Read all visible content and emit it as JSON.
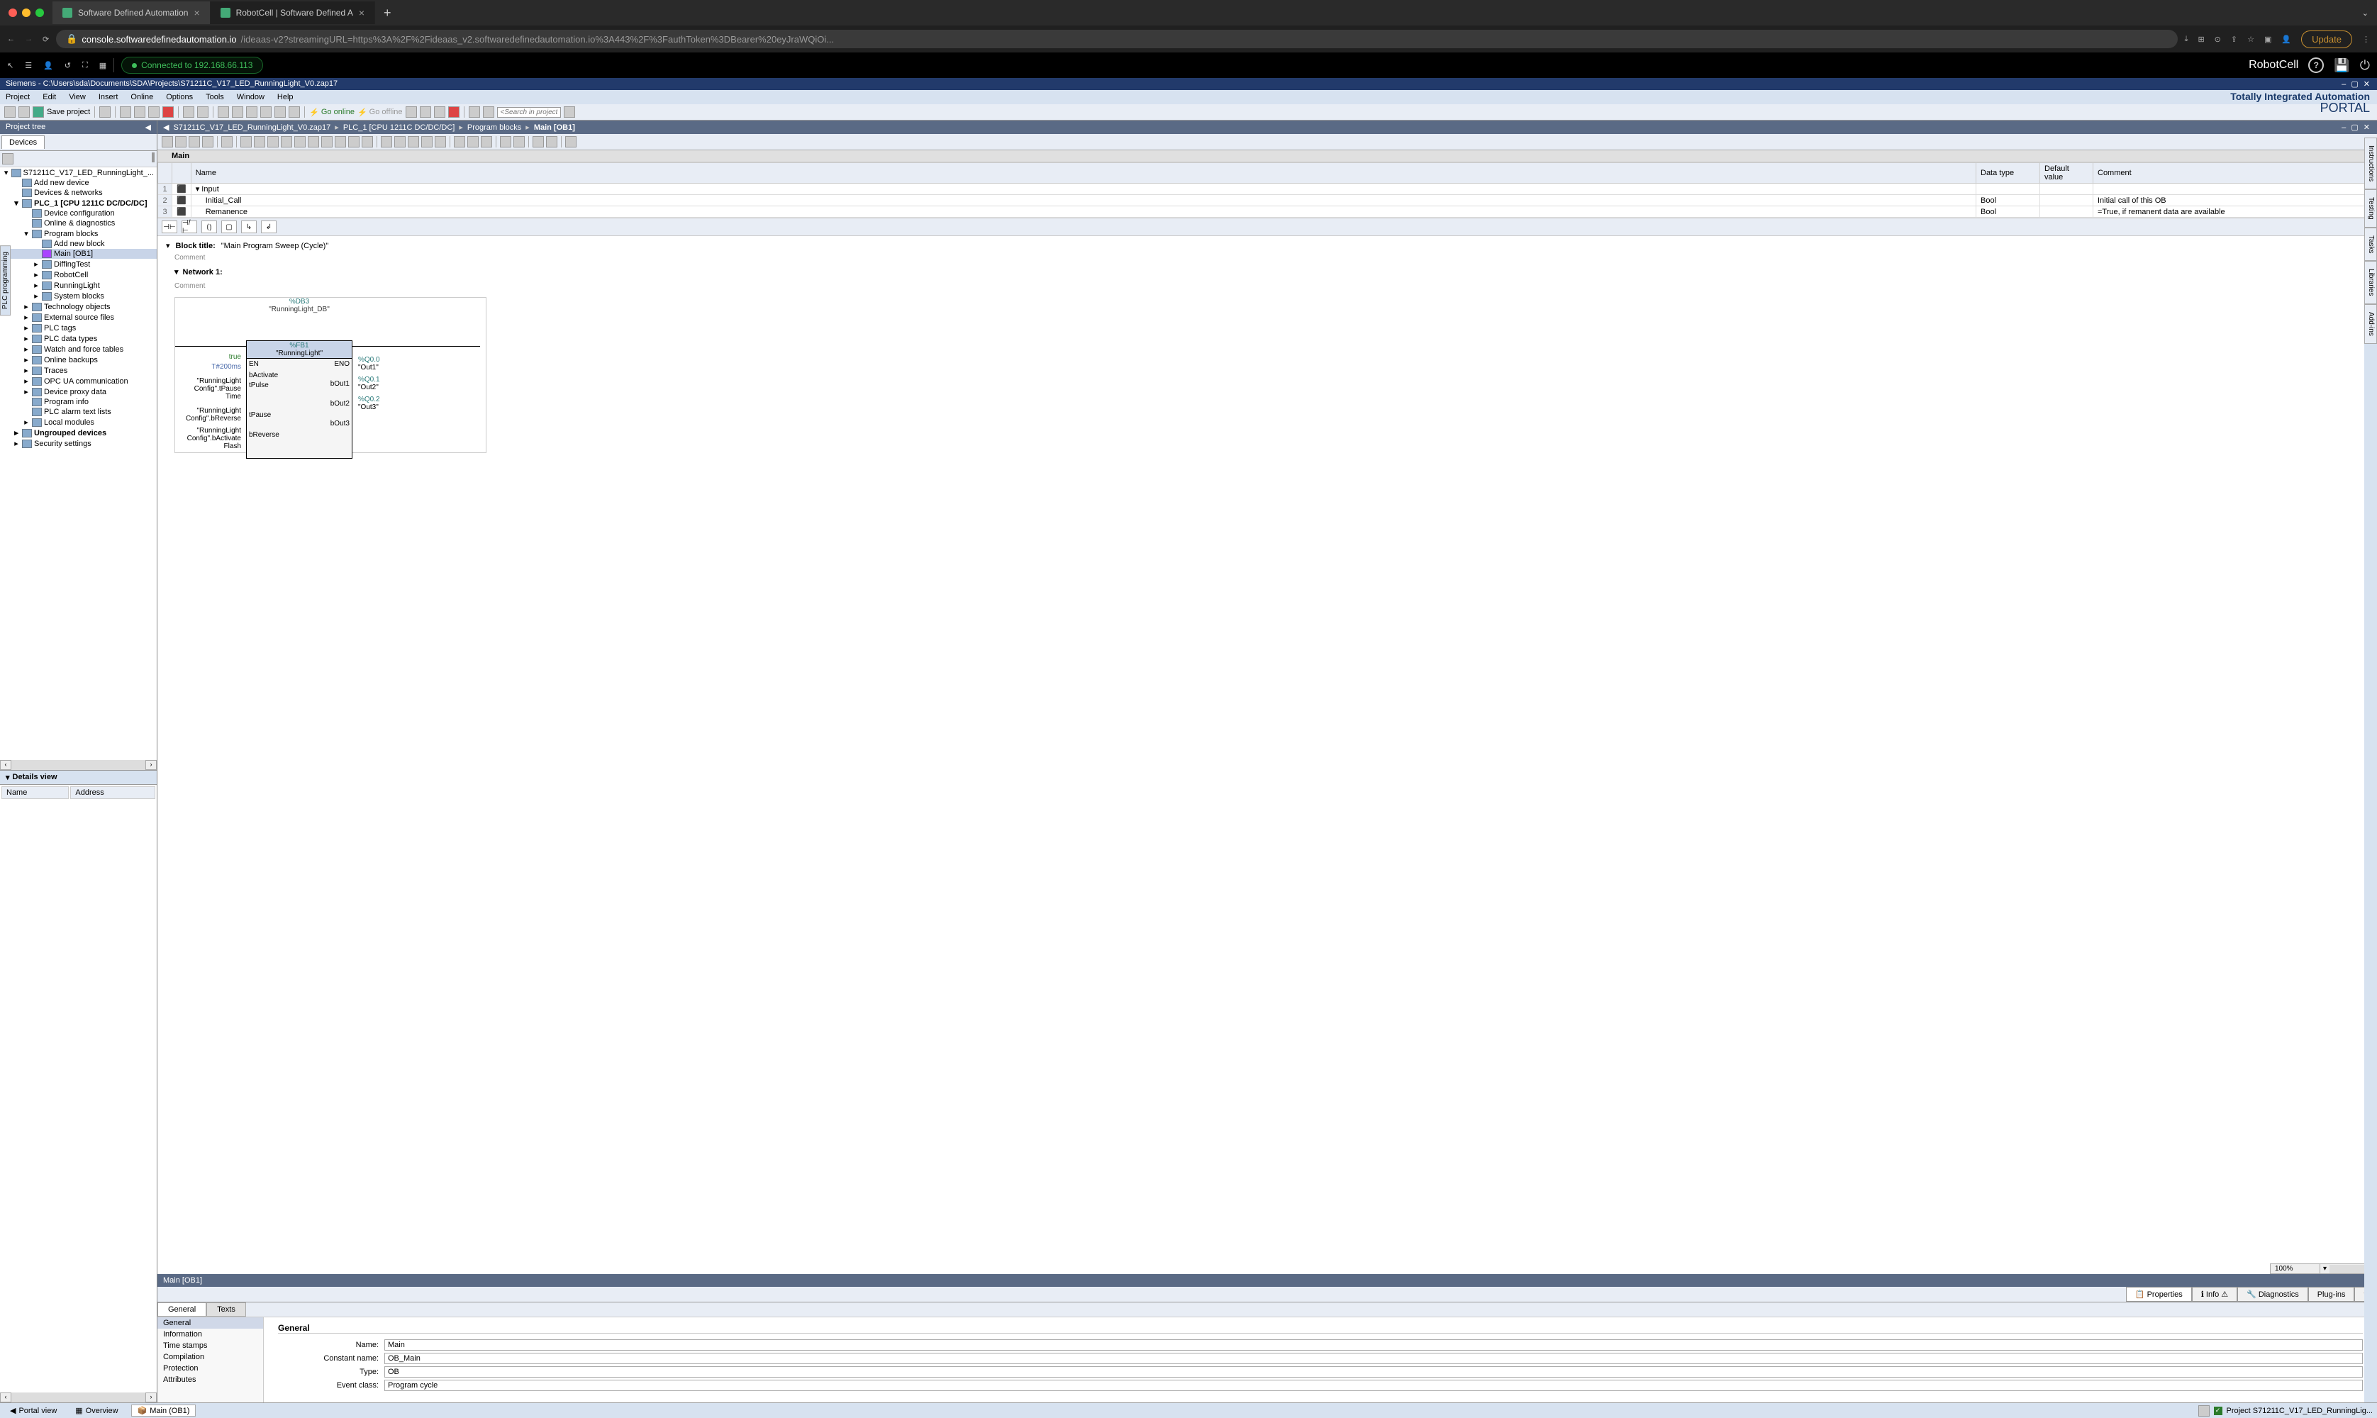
{
  "browser": {
    "tabs": [
      {
        "title": "Software Defined Automation",
        "active": false
      },
      {
        "title": "RobotCell | Software Defined A",
        "active": true
      }
    ],
    "url_domain": "console.softwaredefinedautomation.io",
    "url_path": "/ideaas-v2?streamingURL=https%3A%2F%2Fideaas_v2.softwaredefinedautomation.io%3A443%2F%3FauthToken%3DBearer%20eyJraWQiOi...",
    "update_label": "Update"
  },
  "app_bar": {
    "connected_text": "Connected to 192.168.66.113",
    "title": "RobotCell"
  },
  "tia": {
    "titlebar": "Siemens - C:\\Users\\sda\\Documents\\SDA\\Projects\\S71211C_V17_LED_RunningLight_V0.zap17",
    "branding_top": "Totally Integrated Automation",
    "branding_bottom": "PORTAL",
    "menus": [
      "Project",
      "Edit",
      "View",
      "Insert",
      "Online",
      "Options",
      "Tools",
      "Window",
      "Help"
    ],
    "toolbar": {
      "save_project": "Save project",
      "go_online": "Go online",
      "go_offline": "Go offline",
      "search_placeholder": "<Search in project>"
    },
    "project_tree_label": "Project tree",
    "devices_label": "Devices",
    "tree": [
      {
        "indent": 0,
        "arrow": "▾",
        "label": "S71211C_V17_LED_RunningLight_..."
      },
      {
        "indent": 1,
        "arrow": "",
        "label": "Add new device"
      },
      {
        "indent": 1,
        "arrow": "",
        "label": "Devices & networks"
      },
      {
        "indent": 1,
        "arrow": "▾",
        "label": "PLC_1 [CPU 1211C DC/DC/DC]",
        "bold": true
      },
      {
        "indent": 2,
        "arrow": "",
        "label": "Device configuration"
      },
      {
        "indent": 2,
        "arrow": "",
        "label": "Online & diagnostics"
      },
      {
        "indent": 2,
        "arrow": "▾",
        "label": "Program blocks"
      },
      {
        "indent": 3,
        "arrow": "",
        "label": "Add new block"
      },
      {
        "indent": 3,
        "arrow": "",
        "label": "Main [OB1]",
        "selected": true
      },
      {
        "indent": 3,
        "arrow": "▸",
        "label": "DiffingTest"
      },
      {
        "indent": 3,
        "arrow": "▸",
        "label": "RobotCell"
      },
      {
        "indent": 3,
        "arrow": "▸",
        "label": "RunningLight"
      },
      {
        "indent": 3,
        "arrow": "▸",
        "label": "System blocks"
      },
      {
        "indent": 2,
        "arrow": "▸",
        "label": "Technology objects"
      },
      {
        "indent": 2,
        "arrow": "▸",
        "label": "External source files"
      },
      {
        "indent": 2,
        "arrow": "▸",
        "label": "PLC tags"
      },
      {
        "indent": 2,
        "arrow": "▸",
        "label": "PLC data types"
      },
      {
        "indent": 2,
        "arrow": "▸",
        "label": "Watch and force tables"
      },
      {
        "indent": 2,
        "arrow": "▸",
        "label": "Online backups"
      },
      {
        "indent": 2,
        "arrow": "▸",
        "label": "Traces"
      },
      {
        "indent": 2,
        "arrow": "▸",
        "label": "OPC UA communication"
      },
      {
        "indent": 2,
        "arrow": "▸",
        "label": "Device proxy data"
      },
      {
        "indent": 2,
        "arrow": "",
        "label": "Program info"
      },
      {
        "indent": 2,
        "arrow": "",
        "label": "PLC alarm text lists"
      },
      {
        "indent": 2,
        "arrow": "▸",
        "label": "Local modules"
      },
      {
        "indent": 1,
        "arrow": "▸",
        "label": "Ungrouped devices",
        "bold": true
      },
      {
        "indent": 1,
        "arrow": "▸",
        "label": "Security settings"
      }
    ],
    "details_view_label": "Details view",
    "details_cols": [
      "Name",
      "Address"
    ],
    "breadcrumb": [
      "S71211C_V17_LED_RunningLight_V0.zap17",
      "PLC_1 [CPU 1211C DC/DC/DC]",
      "Program blocks",
      "Main [OB1]"
    ],
    "block_name": "Main",
    "interface_cols": [
      "Name",
      "Data type",
      "Default value",
      "Comment"
    ],
    "interface_rows": [
      {
        "num": "1",
        "name": "Input",
        "type": "",
        "default": "",
        "comment": "",
        "is_header": true
      },
      {
        "num": "2",
        "name": "Initial_Call",
        "type": "Bool",
        "default": "",
        "comment": "Initial call of this OB"
      },
      {
        "num": "3",
        "name": "Remanence",
        "type": "Bool",
        "default": "",
        "comment": "=True, if remanent data are available"
      }
    ],
    "block_title_label": "Block title:",
    "block_title_value": "\"Main Program Sweep (Cycle)\"",
    "comment_label": "Comment",
    "network_label": "Network 1:",
    "diagram": {
      "db_addr": "%DB3",
      "db_name": "\"RunningLight_DB\"",
      "fb_addr": "%FB1",
      "fb_name": "\"RunningLight\"",
      "en": "EN",
      "eno": "ENO",
      "inputs": [
        {
          "param": "bActivate",
          "value": "true",
          "color": "#2a7a2a"
        },
        {
          "param": "tPulse",
          "value": "T#200ms",
          "color": "#4a6aaa"
        },
        {
          "param": "tPause",
          "value": "\"RunningLight Config\".tPause Time"
        },
        {
          "param": "bReverse",
          "value": "\"RunningLight Config\".bReverse"
        },
        {
          "param": "",
          "value": "\"RunningLight Config\".bActivate Flash"
        }
      ],
      "outputs": [
        {
          "param": "bOut1",
          "addr": "%Q0.0",
          "name": "\"Out1\""
        },
        {
          "param": "bOut2",
          "addr": "%Q0.1",
          "name": "\"Out2\""
        },
        {
          "param": "bOut3",
          "addr": "%Q0.2",
          "name": "\"Out3\""
        }
      ]
    },
    "zoom": "100%",
    "inspector": {
      "header": "Main [OB1]",
      "tabs": [
        "Properties",
        "Info",
        "Diagnostics",
        "Plug-ins"
      ],
      "subtabs": [
        "General",
        "Texts"
      ],
      "sidebar": [
        "General",
        "Information",
        "Time stamps",
        "Compilation",
        "Protection",
        "Attributes"
      ],
      "section_title": "General",
      "props": [
        {
          "label": "Name:",
          "value": "Main"
        },
        {
          "label": "Constant name:",
          "value": "OB_Main"
        },
        {
          "label": "Type:",
          "value": "OB"
        },
        {
          "label": "Event class:",
          "value": "Program cycle"
        }
      ]
    },
    "statusbar": {
      "portal_view": "Portal view",
      "overview": "Overview",
      "main": "Main (OB1)",
      "status": "Project S71211C_V17_LED_RunningLig..."
    },
    "right_tabs": [
      "Instructions",
      "Testing",
      "Tasks",
      "Libraries",
      "Add-ins"
    ],
    "left_side_tab": "PLC programming"
  }
}
